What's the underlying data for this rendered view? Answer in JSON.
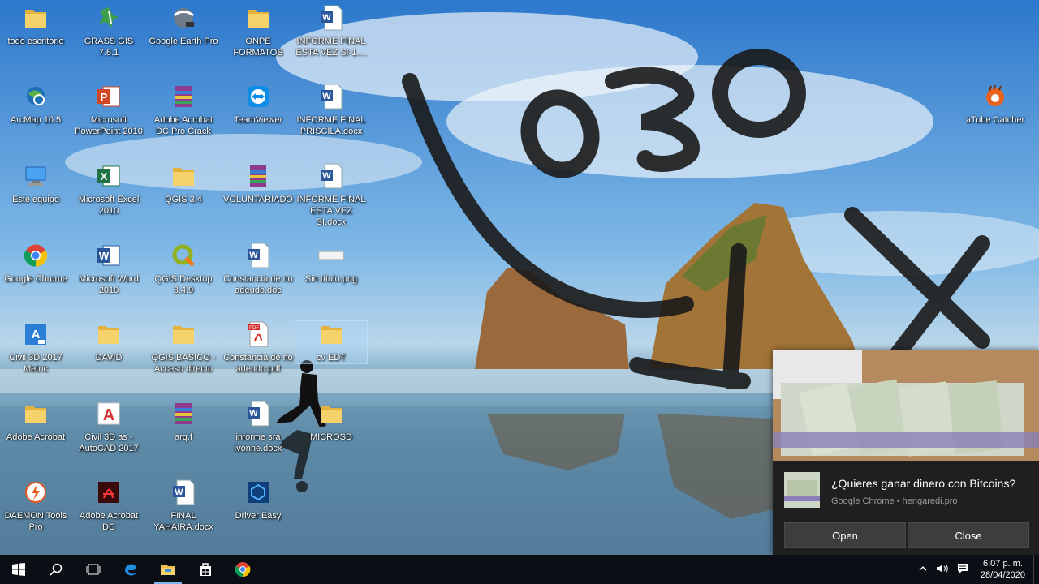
{
  "desktop": {
    "icons": [
      {
        "label": "todo escritorio",
        "icon": "folder-icon"
      },
      {
        "label": "GRASS GIS 7.6.1",
        "icon": "grass-gis-icon"
      },
      {
        "label": "Google Earth Pro",
        "icon": "google-earth-icon"
      },
      {
        "label": "ONPE FORMATOS",
        "icon": "folder-icon"
      },
      {
        "label": "INFORME FINAL ESTA VEZ SI-1....",
        "icon": "word-doc-icon"
      },
      {
        "label": "ArcMap 10.5",
        "icon": "arcmap-icon"
      },
      {
        "label": "Microsoft PowerPoint 2010",
        "icon": "powerpoint-icon"
      },
      {
        "label": "Adobe Acrobat DC Pro Crack",
        "icon": "winrar-icon"
      },
      {
        "label": "TeamViewer",
        "icon": "teamviewer-icon"
      },
      {
        "label": "INFORME FINAL PRISCILA.docx",
        "icon": "word-doc-icon"
      },
      {
        "label": "Este equipo",
        "icon": "computer-icon"
      },
      {
        "label": "Microsoft Excel 2010",
        "icon": "excel-icon"
      },
      {
        "label": "QGIS 3.4",
        "icon": "folder-icon"
      },
      {
        "label": "VOLUNTARIADO",
        "icon": "winrar-icon"
      },
      {
        "label": "INFORME FINAL ESTA VEZ SI.docx",
        "icon": "word-doc-icon"
      },
      {
        "label": "Google Chrome",
        "icon": "chrome-icon"
      },
      {
        "label": "Microsoft Word 2010",
        "icon": "word-icon"
      },
      {
        "label": "QGIS Desktop 3.4.9",
        "icon": "qgis-icon"
      },
      {
        "label": "Constancia de no adeudo.doc",
        "icon": "word-doc-icon"
      },
      {
        "label": "Sin título.png",
        "icon": "image-file-icon"
      },
      {
        "label": "Civil 3D 2017 Metric",
        "icon": "civil3d-icon"
      },
      {
        "label": "DAVID",
        "icon": "folder-icon"
      },
      {
        "label": "QGIS BASICO - Acceso directo",
        "icon": "folder-icon"
      },
      {
        "label": "Constancia de no adeudo.pdf",
        "icon": "pdf-icon"
      },
      {
        "label": "cv EDT",
        "icon": "folder-icon"
      },
      {
        "label": "Adobe Acrobat",
        "icon": "folder-icon"
      },
      {
        "label": "Civil 3D as - AutoCAD 2017",
        "icon": "autocad-icon"
      },
      {
        "label": "arq.f",
        "icon": "winrar-icon"
      },
      {
        "label": "informe sra ivonne.docx",
        "icon": "word-doc-icon"
      },
      {
        "label": "MICROSD",
        "icon": "folder-icon"
      },
      {
        "label": "DAEMON Tools Pro",
        "icon": "daemon-tools-icon"
      },
      {
        "label": "Adobe Acrobat DC",
        "icon": "acrobat-icon"
      },
      {
        "label": "FINAL YAHAIRA.docx",
        "icon": "word-doc-icon"
      },
      {
        "label": "Driver Easy",
        "icon": "driver-easy-icon"
      },
      {
        "label": "aTube Catcher",
        "icon": "atube-catcher-icon"
      }
    ],
    "selected_icon": "cv EDT"
  },
  "notification": {
    "title": "¿Quieres ganar dinero con Bitcoins?",
    "source": "Google Chrome • hengaredi.pro",
    "open_label": "Open",
    "close_label": "Close"
  },
  "taskbar": {
    "buttons": [
      "windows-start-icon",
      "search-icon",
      "task-view-icon",
      "edge-icon",
      "file-explorer-icon",
      "store-icon",
      "chrome-icon"
    ],
    "active": "file-explorer-icon",
    "time": "6:07 p. m.",
    "date": "28/04/2020"
  },
  "colors": {
    "taskbar": "#0b0e14",
    "toast": "#1f1f1f",
    "toast_button": "#3d3d3d",
    "accent": "#7fb6f0"
  }
}
